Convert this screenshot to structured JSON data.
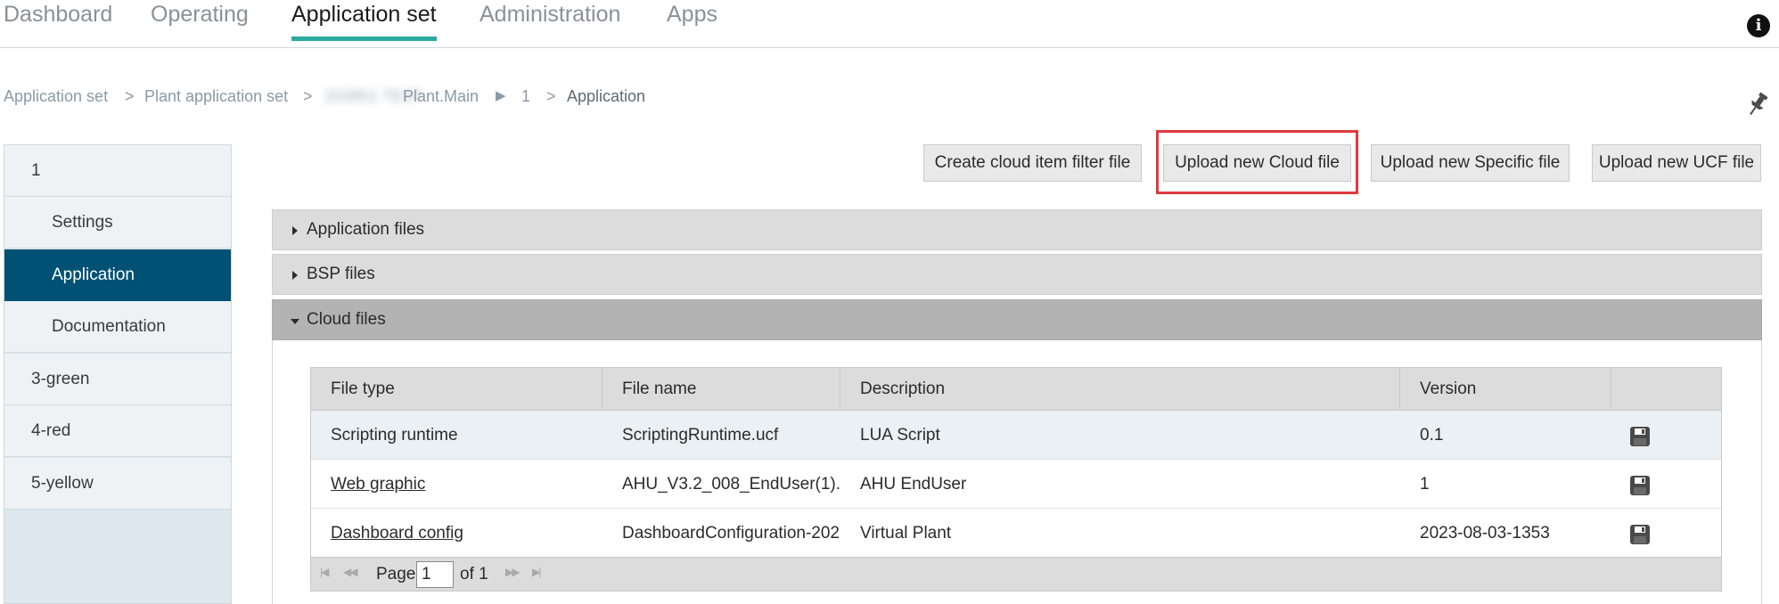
{
  "topnav": {
    "tabs": [
      {
        "label": "Dashboard",
        "active": false
      },
      {
        "label": "Operating",
        "active": false
      },
      {
        "label": "Application set",
        "active": true
      },
      {
        "label": "Administration",
        "active": false
      },
      {
        "label": "Apps",
        "active": false
      }
    ],
    "info_icon": "info-icon"
  },
  "breadcrumb": {
    "items": [
      "Application set",
      "Plant application set",
      "Plant.Main",
      "1",
      "Application"
    ],
    "blurred_prefix": "203851 TEST",
    "separators": [
      ">",
      ">",
      "▶",
      ">"
    ]
  },
  "sidebar": {
    "items": [
      {
        "label": "1",
        "level": 1
      },
      {
        "label": "Settings",
        "level": 2
      },
      {
        "label": "Application",
        "level": 2,
        "active": true
      },
      {
        "label": "Documentation",
        "level": 2
      },
      {
        "label": "3-green",
        "level": 1
      },
      {
        "label": "4-red",
        "level": 1
      },
      {
        "label": "5-yellow",
        "level": 1
      }
    ]
  },
  "actions": {
    "create_filter": "Create cloud item filter file",
    "upload_cloud": "Upload new Cloud file",
    "upload_specific": "Upload new Specific file",
    "upload_ucf": "Upload new UCF file"
  },
  "accordions": [
    {
      "label": "Application files",
      "expanded": false
    },
    {
      "label": "BSP files",
      "expanded": false
    },
    {
      "label": "Cloud files",
      "expanded": true
    }
  ],
  "grid": {
    "columns": [
      "File type",
      "File name",
      "Description",
      "Version",
      ""
    ],
    "rows": [
      {
        "file_type": "Scripting runtime",
        "file_name": "ScriptingRuntime.ucf",
        "description": "LUA Script",
        "version": "0.1",
        "link": false,
        "selected": true
      },
      {
        "file_type": "Web graphic",
        "file_name": "AHU_V3.2_008_EndUser(1).:",
        "description": "AHU EndUser",
        "version": "1",
        "link": true,
        "selected": false
      },
      {
        "file_type": "Dashboard config",
        "file_name": "DashboardConfiguration-202",
        "description": "Virtual Plant",
        "version": "2023-08-03-1353",
        "link": true,
        "selected": false
      }
    ],
    "pager": {
      "page_label": "Page",
      "page_value": "1",
      "of_label": "of 1"
    }
  },
  "colors": {
    "accent_teal": "#2aa9a0",
    "sidebar_active": "#005173",
    "highlight_red": "#e0393e"
  }
}
